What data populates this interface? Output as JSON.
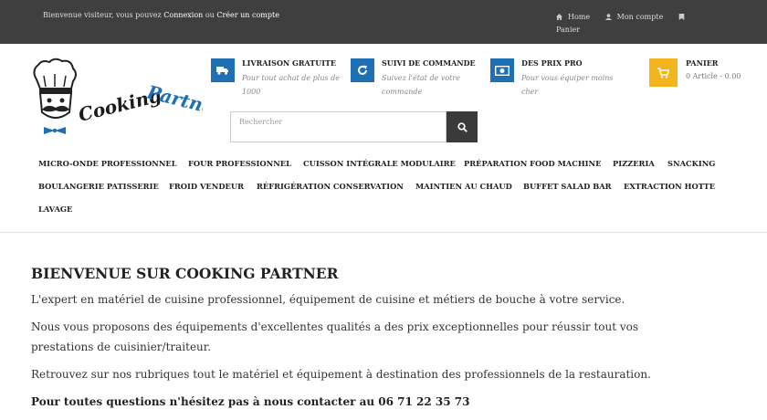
{
  "topbar": {
    "welcome_prefix": "Bienvenue visiteur, vous pouvez",
    "login_label": "Connexion",
    "or_label": "ou",
    "signup_label": "Créer un compte",
    "home_label": "Home",
    "account_label": "Mon compte",
    "cart_label": "Panier"
  },
  "logo": {
    "text_1": "Cooking",
    "text_2": "Partner"
  },
  "features": [
    {
      "title": "LIVRAISON GRATUITE",
      "desc": "Pour tout achat de plus de 1000",
      "icon": "truck-icon"
    },
    {
      "title": "SUIVI DE COMMANDE",
      "desc": "Suivez l'état de votre commande",
      "icon": "refresh-icon"
    },
    {
      "title": "DES PRIX PRO",
      "desc": "Pour vous équiper moins cher",
      "icon": "money-icon"
    }
  ],
  "cart": {
    "title": "PANIER",
    "info": "0 Article - 0.00"
  },
  "search": {
    "placeholder": "Rechercher"
  },
  "menu": {
    "row1": [
      "MICRO-ONDE PROFESSIONNEL",
      "FOUR PROFESSIONNEL",
      "CUISSON INTÉGRALE MODULAIRE",
      "PRÉPARATION FOOD MACHINE",
      "PIZZERIA",
      "SNACKING"
    ],
    "row2": [
      "BOULANGERIE PATISSERIE",
      "FROID VENDEUR",
      "RÉFRIGÉRATION CONSERVATION",
      "MAINTIEN AU CHAUD",
      "BUFFET SALAD BAR",
      "EXTRACTION HOTTE"
    ],
    "row3": [
      "LAVAGE"
    ]
  },
  "content": {
    "heading": "BIENVENUE SUR COOKING PARTNER",
    "p1": "L'expert en matériel de cuisine professionnel, équipement de cuisine et métiers de bouche à votre service.",
    "p2": "Nous vous proposons des équipements d'excellentes qualités a des prix exceptionnelles pour réussir tout vos prestations de cuisinier/traiteur.",
    "p3": "Retrouvez sur nos rubriques tout le matériel et équipement à destination des professionnels de la restauration.",
    "p4": "Pour toutes questions n'hésitez pas à nous contacter au 06 71 22 35 73"
  },
  "colors": {
    "topbar_bg": "#3f3f3f",
    "feature_blue": "#1f6fb5",
    "cart_yellow": "#f3b51b",
    "search_button": "#3a3a3a"
  }
}
